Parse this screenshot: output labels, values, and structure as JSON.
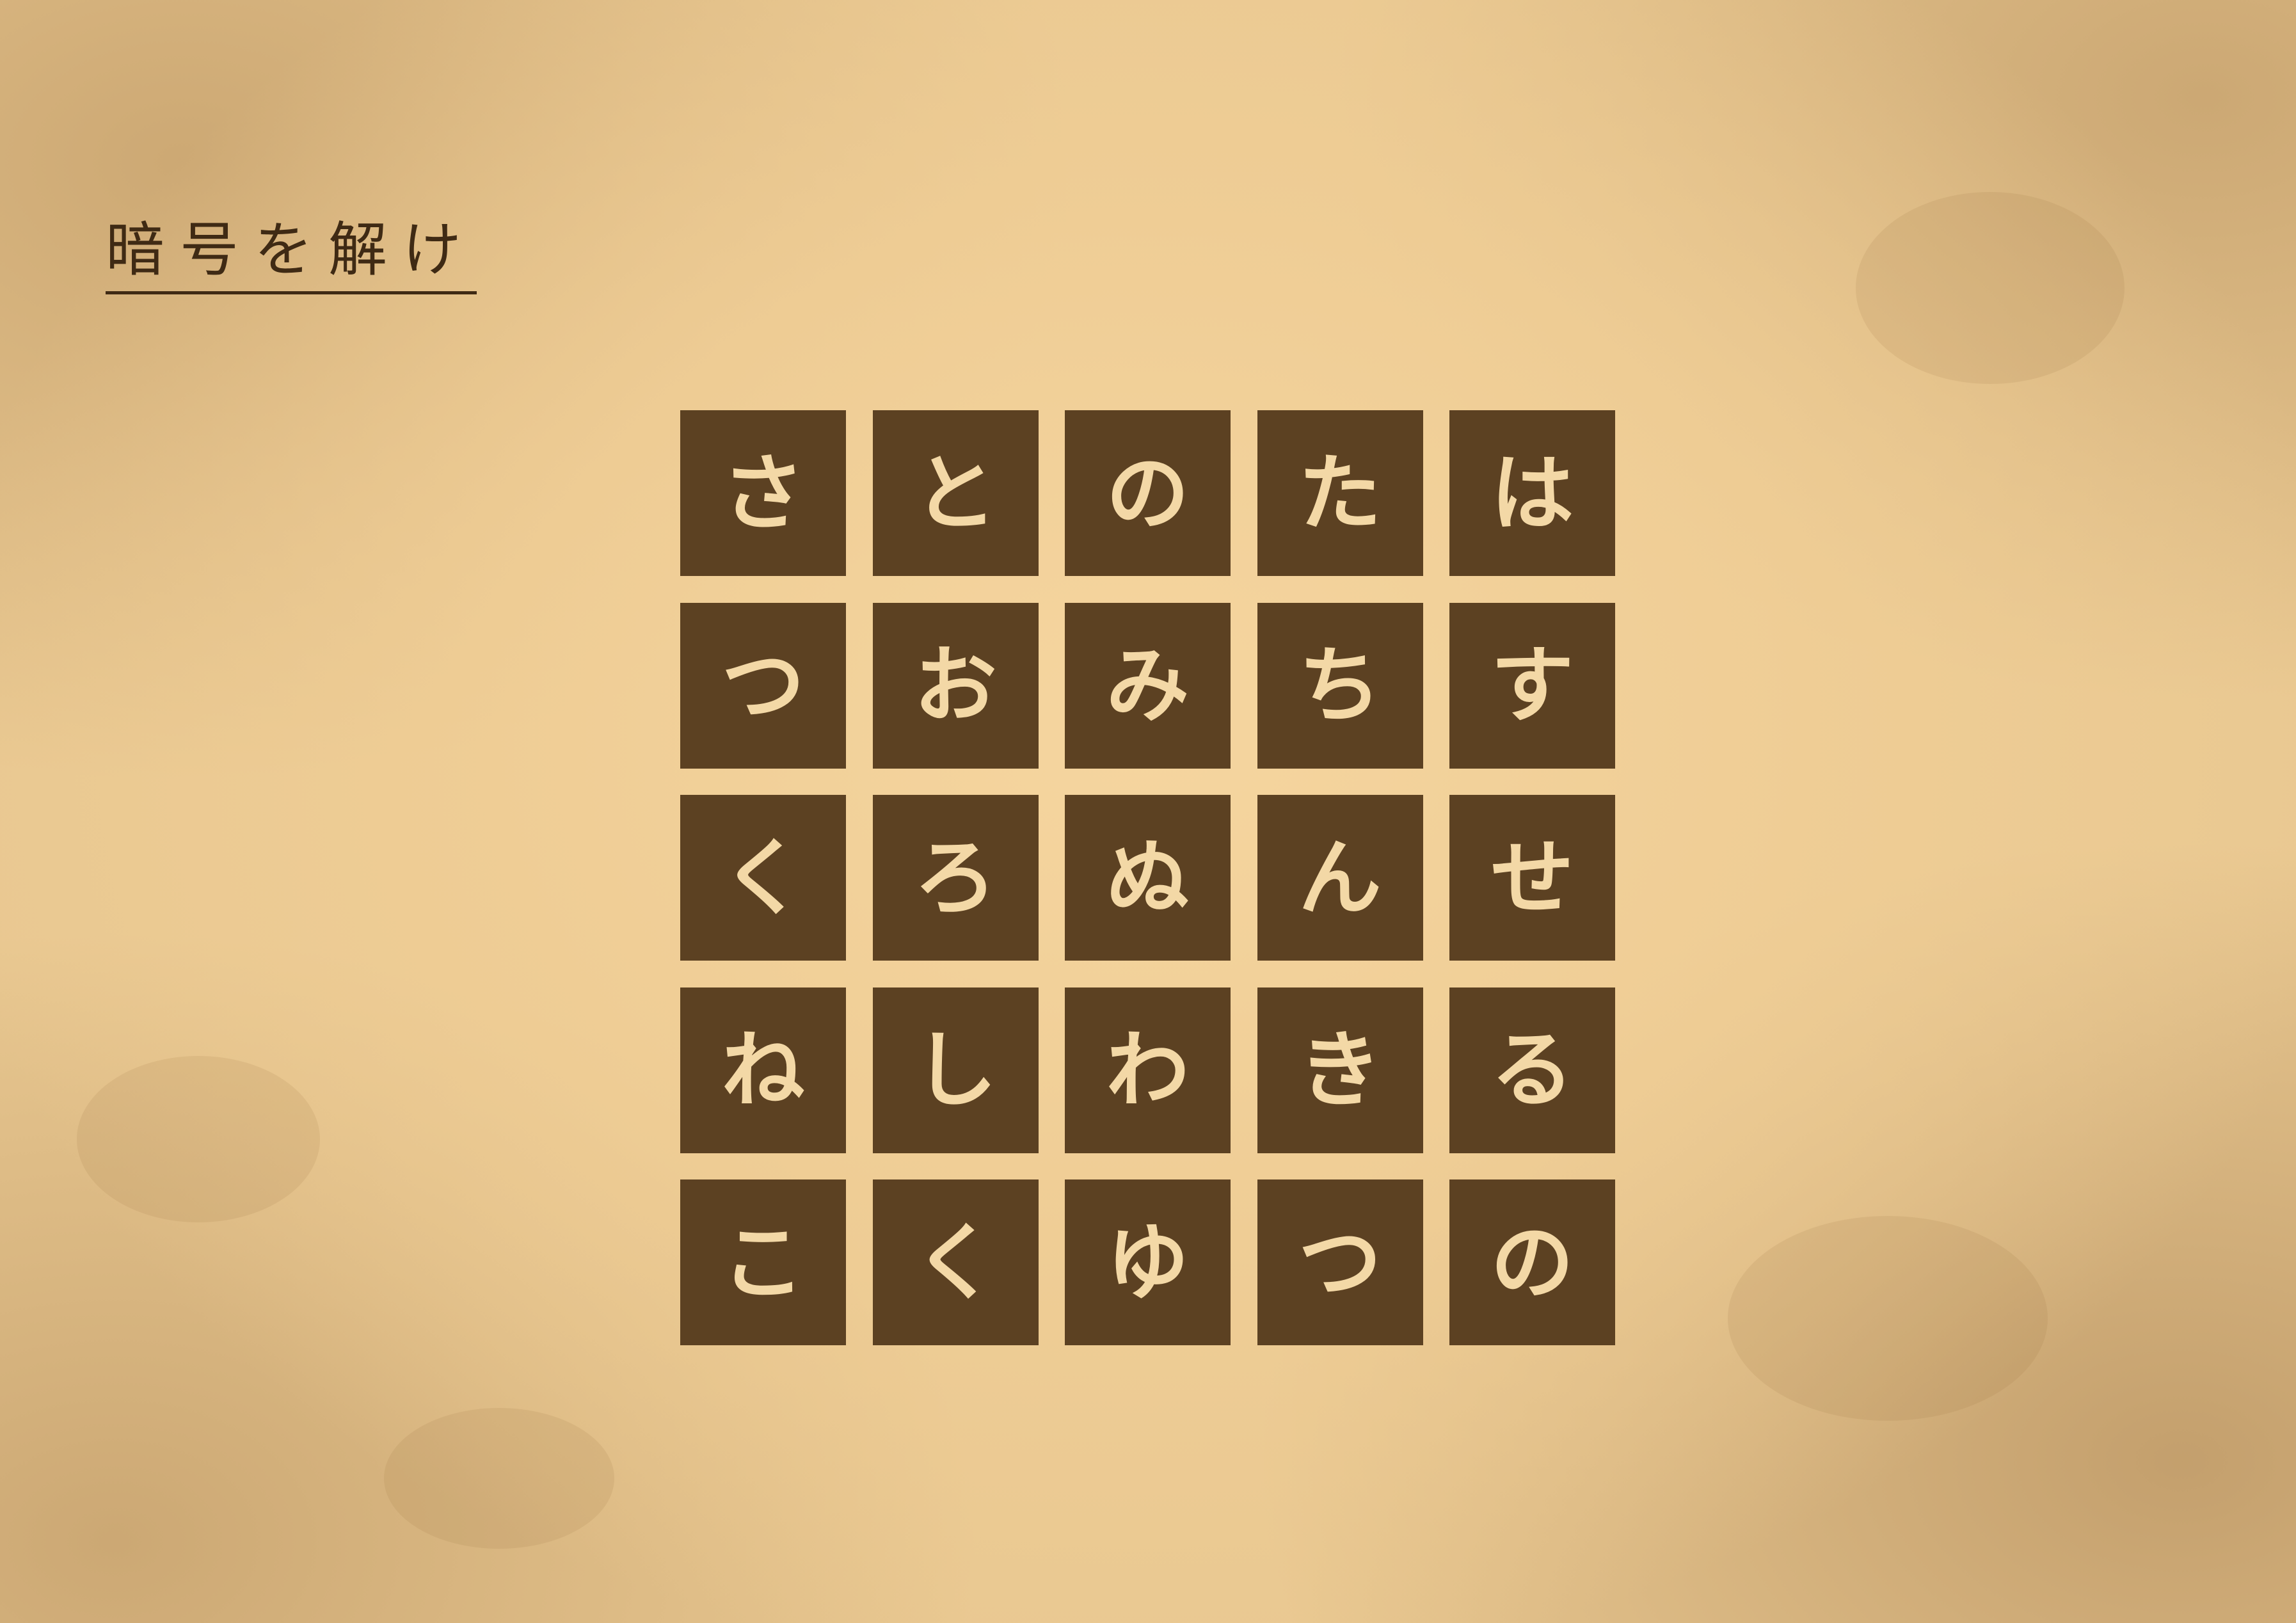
{
  "title": "暗号を解け",
  "grid": {
    "rows": [
      [
        "さ",
        "と",
        "の",
        "た",
        "は"
      ],
      [
        "つ",
        "お",
        "み",
        "ち",
        "す"
      ],
      [
        "く",
        "ろ",
        "ぬ",
        "ん",
        "せ"
      ],
      [
        "ね",
        "し",
        "わ",
        "き",
        "る"
      ],
      [
        "こ",
        "く",
        "ゆ",
        "つ",
        "の"
      ]
    ]
  },
  "colors": {
    "tile": "#5c4122",
    "tile_text": "#f3d8a6",
    "title_text": "#3f2a14",
    "paper": "#e9c891"
  }
}
